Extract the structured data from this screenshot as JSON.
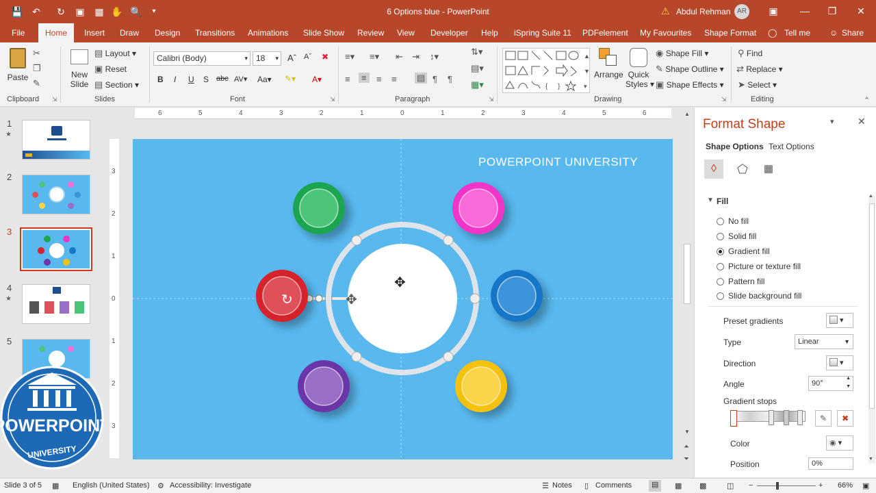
{
  "titlebar": {
    "title": "6 Options blue  -  PowerPoint",
    "user": "Abdul Rehman",
    "user_initials": "AR"
  },
  "tabs": [
    "File",
    "Home",
    "Insert",
    "Draw",
    "Design",
    "Transitions",
    "Animations",
    "Slide Show",
    "Review",
    "View",
    "Developer",
    "Help",
    "iSpring Suite 11",
    "PDFelement",
    "My Favourites",
    "Shape Format",
    "Tell me",
    "Share"
  ],
  "ribbon": {
    "clipboard": {
      "paste": "Paste",
      "label": "Clipboard"
    },
    "slides": {
      "new_slide_1": "New",
      "new_slide_2": "Slide",
      "layout": "Layout",
      "reset": "Reset",
      "section": "Section",
      "label": "Slides"
    },
    "font": {
      "family": "Calibri (Body)",
      "size": "18",
      "label": "Font"
    },
    "paragraph": {
      "label": "Paragraph"
    },
    "drawing": {
      "arrange": "Arrange",
      "quick_styles_1": "Quick",
      "quick_styles_2": "Styles",
      "shape_fill": "Shape Fill",
      "shape_outline": "Shape Outline",
      "shape_effects": "Shape Effects",
      "label": "Drawing"
    },
    "editing": {
      "find": "Find",
      "replace": "Replace",
      "select": "Select",
      "label": "Editing"
    }
  },
  "thumbnails": [
    {
      "num": "1",
      "starred": true
    },
    {
      "num": "2",
      "starred": false
    },
    {
      "num": "3",
      "starred": false
    },
    {
      "num": "4",
      "starred": true
    },
    {
      "num": "5",
      "starred": false
    }
  ],
  "slide": {
    "title": "POWERPOINT UNIVERSITY",
    "background": "#59b9ef",
    "options": [
      {
        "color": "#1ea54f",
        "inner": "#4cc57a"
      },
      {
        "color": "#f035c8",
        "inner": "#f76ad8"
      },
      {
        "color": "#d6202a",
        "inner": "#e05058"
      },
      {
        "color": "#1577c9",
        "inner": "#3d93da"
      },
      {
        "color": "#6a36a8",
        "inner": "#9a6fc8"
      },
      {
        "color": "#f4c10f",
        "inner": "#fad54a"
      }
    ]
  },
  "pane": {
    "title": "Format Shape",
    "tab_shape": "Shape Options",
    "tab_text": "Text Options",
    "section": "Fill",
    "fill_options": [
      "No fill",
      "Solid fill",
      "Gradient fill",
      "Picture or texture fill",
      "Pattern fill",
      "Slide background fill"
    ],
    "selected_fill": "Gradient fill",
    "preset_gradients": "Preset gradients",
    "type_label": "Type",
    "type_value": "Linear",
    "direction_label": "Direction",
    "angle_label": "Angle",
    "angle_value": "90°",
    "gradient_stops": "Gradient stops",
    "color_label": "Color",
    "position_label": "Position",
    "position_value": "0%"
  },
  "status": {
    "slide": "Slide 3 of 5",
    "language": "English (United States)",
    "accessibility": "Accessibility: Investigate",
    "notes": "Notes",
    "comments": "Comments",
    "zoom": "66%"
  },
  "logo": {
    "line1": "POWERPOINT",
    "line2": "UNIVERSITY"
  }
}
